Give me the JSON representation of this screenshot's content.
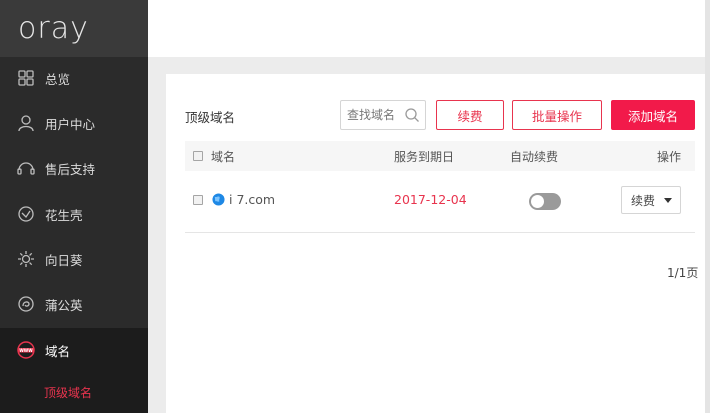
{
  "brand": {
    "logo": "oray"
  },
  "sidebar": {
    "items": [
      {
        "label": "总览",
        "icon": "grid-icon"
      },
      {
        "label": "用户中心",
        "icon": "user-icon"
      },
      {
        "label": "售后支持",
        "icon": "headset-icon"
      },
      {
        "label": "花生壳",
        "icon": "shell-icon"
      },
      {
        "label": "向日葵",
        "icon": "sunflower-icon"
      },
      {
        "label": "蒲公英",
        "icon": "dandelion-icon"
      },
      {
        "label": "域名",
        "icon": "www-icon",
        "active": true
      }
    ],
    "sub_active": "顶级域名"
  },
  "main": {
    "title": "顶级域名",
    "search_placeholder": "查找域名",
    "buttons": {
      "renew": "续费",
      "batch": "批量操作",
      "add": "添加域名"
    },
    "table": {
      "headers": {
        "domain": "域名",
        "expire": "服务到期日",
        "auto_renew": "自动续费",
        "actions": "操作"
      },
      "rows": [
        {
          "domain": "i  7.com",
          "expire": "2017-12-04",
          "auto_renew": false,
          "action": "续费"
        }
      ]
    },
    "pagination": "1/1页"
  },
  "colors": {
    "accent": "#e8344e",
    "primary_button": "#f21a4a",
    "sidebar_bg": "#2b2b2b"
  }
}
